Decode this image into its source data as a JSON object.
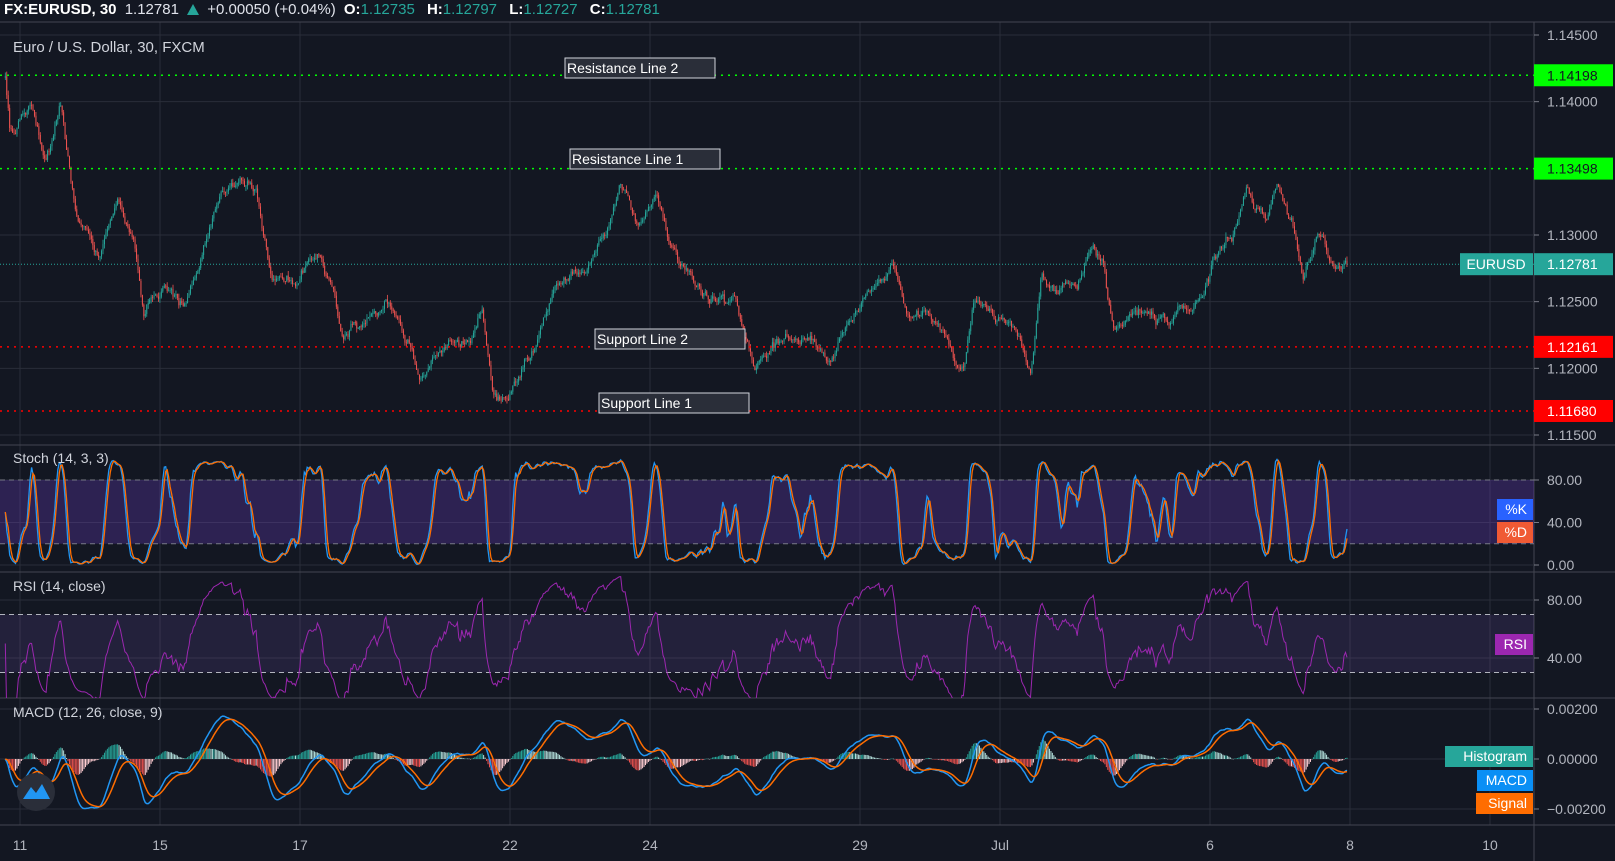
{
  "header": {
    "symbol": "FX:EURUSD, 30",
    "last": "1.12781",
    "change": "+0.00050 (+0.04%)",
    "ohlc": [
      {
        "label": "O:",
        "value": "1.12735"
      },
      {
        "label": "H:",
        "value": "1.12797"
      },
      {
        "label": "L:",
        "value": "1.12727"
      },
      {
        "label": "C:",
        "value": "1.12781"
      }
    ]
  },
  "colors": {
    "background": "#131722",
    "grid": "#2a2e39",
    "up": "#26a69a",
    "down": "#ef5350",
    "k": "#2196f3",
    "d": "#ff6d00",
    "rsi": "#9c27b0",
    "macd": "#2196f3",
    "signal": "#ff6d00",
    "resistance": "#00ff00",
    "support": "#ff0000"
  },
  "chart_data": {
    "type": "candlestick",
    "title": "Euro / U.S. Dollar, 30, FXCM",
    "interval_minutes": 30,
    "x_unit": "trading days since Jun 11",
    "x_ticks": [
      {
        "t": 0,
        "label": "11"
      },
      {
        "t": 2,
        "label": "15"
      },
      {
        "t": 4,
        "label": "17"
      },
      {
        "t": 7,
        "label": "22"
      },
      {
        "t": 9,
        "label": "24"
      },
      {
        "t": 12,
        "label": "29"
      },
      {
        "t": 14,
        "label": "Jul"
      },
      {
        "t": 17,
        "label": "6"
      },
      {
        "t": 19,
        "label": "8"
      },
      {
        "t": 21,
        "label": "10"
      }
    ],
    "price": {
      "ylim": [
        1.1145,
        1.1461
      ],
      "ticks": [
        {
          "v": 1.145,
          "label": "1.14500"
        },
        {
          "v": 1.14,
          "label": "1.14000"
        },
        {
          "v": 1.13,
          "label": "1.13000"
        },
        {
          "v": 1.125,
          "label": "1.12500"
        },
        {
          "v": 1.12,
          "label": "1.12000"
        },
        {
          "v": 1.115,
          "label": "1.11500"
        }
      ],
      "last_value": 1.12781,
      "last_label": "1.12781",
      "symbol_label": "EURUSD",
      "anchors": [
        [
          -0.21,
          1.1418
        ],
        [
          -0.14,
          1.1375
        ],
        [
          0.15,
          1.1395
        ],
        [
          0.37,
          1.1352
        ],
        [
          0.59,
          1.1398
        ],
        [
          0.81,
          1.131
        ],
        [
          1.11,
          1.1283
        ],
        [
          1.4,
          1.1329
        ],
        [
          1.62,
          1.1298
        ],
        [
          1.77,
          1.1237
        ],
        [
          2.06,
          1.126
        ],
        [
          2.35,
          1.1245
        ],
        [
          2.57,
          1.1275
        ],
        [
          2.79,
          1.1322
        ],
        [
          3.16,
          1.1345
        ],
        [
          3.38,
          1.1333
        ],
        [
          3.6,
          1.1268
        ],
        [
          3.89,
          1.1268
        ],
        [
          4.26,
          1.1283
        ],
        [
          4.48,
          1.1252
        ],
        [
          4.62,
          1.1222
        ],
        [
          4.99,
          1.1245
        ],
        [
          5.28,
          1.1252
        ],
        [
          5.58,
          1.1222
        ],
        [
          5.72,
          1.1198
        ],
        [
          6.02,
          1.121
        ],
        [
          6.46,
          1.1222
        ],
        [
          6.6,
          1.1245
        ],
        [
          6.75,
          1.1183
        ],
        [
          6.97,
          1.1179
        ],
        [
          7.34,
          1.1214
        ],
        [
          7.63,
          1.126
        ],
        [
          8.07,
          1.1275
        ],
        [
          8.36,
          1.1302
        ],
        [
          8.58,
          1.1337
        ],
        [
          8.8,
          1.1314
        ],
        [
          9.09,
          1.1322
        ],
        [
          9.39,
          1.1283
        ],
        [
          9.83,
          1.1252
        ],
        [
          10.19,
          1.1245
        ],
        [
          10.49,
          1.1202
        ],
        [
          10.85,
          1.1222
        ],
        [
          11.29,
          1.1222
        ],
        [
          11.59,
          1.121
        ],
        [
          11.88,
          1.1237
        ],
        [
          12.17,
          1.1252
        ],
        [
          12.47,
          1.1283
        ],
        [
          12.69,
          1.1237
        ],
        [
          12.98,
          1.1245
        ],
        [
          13.27,
          1.1214
        ],
        [
          13.49,
          1.1202
        ],
        [
          13.64,
          1.1248
        ],
        [
          13.93,
          1.1237
        ],
        [
          14.22,
          1.1229
        ],
        [
          14.44,
          1.1198
        ],
        [
          14.59,
          1.1268
        ],
        [
          14.81,
          1.1256
        ],
        [
          15.1,
          1.1264
        ],
        [
          15.32,
          1.1298
        ],
        [
          15.47,
          1.1283
        ],
        [
          15.62,
          1.1229
        ],
        [
          15.98,
          1.1245
        ],
        [
          16.42,
          1.1233
        ],
        [
          16.86,
          1.1248
        ],
        [
          17.08,
          1.1283
        ],
        [
          17.3,
          1.1298
        ],
        [
          17.52,
          1.1333
        ],
        [
          17.82,
          1.131
        ],
        [
          17.96,
          1.1329
        ],
        [
          18.18,
          1.1306
        ],
        [
          18.33,
          1.1268
        ],
        [
          18.55,
          1.1298
        ],
        [
          18.77,
          1.1275
        ],
        [
          18.96,
          1.12781
        ]
      ],
      "horizontal_lines": [
        {
          "name": "Resistance Line 2",
          "value": 1.14198,
          "value_label": "1.14198",
          "kind": "resistance"
        },
        {
          "name": "Resistance Line 1",
          "value": 1.13498,
          "value_label": "1.13498",
          "kind": "resistance"
        },
        {
          "name": "Support Line 2",
          "value": 1.12161,
          "value_label": "1.12161",
          "kind": "support"
        },
        {
          "name": "Support Line 1",
          "value": 1.1168,
          "value_label": "1.11680",
          "kind": "support"
        }
      ]
    },
    "stoch": {
      "title": "Stoch (14, 3, 3)",
      "params": [
        14,
        3,
        3
      ],
      "ylim": [
        0,
        100
      ],
      "band": [
        20,
        80
      ],
      "ticks": [
        {
          "v": 80,
          "label": "80.00"
        },
        {
          "v": 40,
          "label": "40.00"
        },
        {
          "v": 0,
          "label": "0.00"
        }
      ],
      "legend": [
        "%K",
        "%D"
      ]
    },
    "rsi": {
      "title": "RSI (14, close)",
      "period": 14,
      "band": [
        30,
        70
      ],
      "ticks": [
        {
          "v": 80,
          "label": "80.00"
        },
        {
          "v": 40,
          "label": "40.00"
        }
      ],
      "legend": [
        "RSI"
      ]
    },
    "macd": {
      "title": "MACD (12, 26, close, 9)",
      "params": [
        12,
        26,
        9
      ],
      "ticks": [
        {
          "v": 0.002,
          "label": "0.00200"
        },
        {
          "v": 0,
          "label": "0.00000"
        },
        {
          "v": -0.002,
          "label": "−0.00200"
        }
      ],
      "legend": [
        "Histogram",
        "MACD",
        "Signal"
      ]
    }
  }
}
